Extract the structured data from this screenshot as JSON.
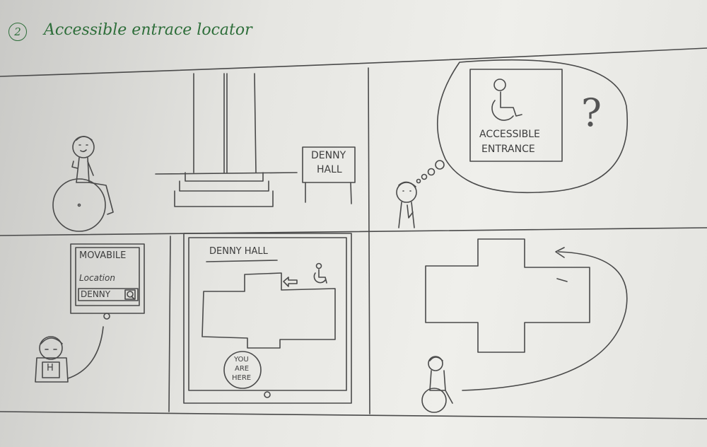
{
  "title": {
    "number": "2",
    "text": "Accessible entrace locator"
  },
  "panel1": {
    "sign_line1": "DENNY",
    "sign_line2": "HALL"
  },
  "panel2": {
    "sign_line1": "ACCESSIBLE",
    "sign_line2": "ENTRANCE",
    "question": "?"
  },
  "panel3": {
    "app_name": "MOVABILE",
    "field_label": "Location",
    "field_value": "DENNY",
    "badge_letter": "H"
  },
  "panel4": {
    "map_title": "DENNY HALL",
    "marker_line1": "YOU",
    "marker_line2": "ARE",
    "marker_line3": "HERE"
  },
  "colors": {
    "ink": "#4a4a4a",
    "title_green": "#2e6e3a"
  },
  "icons": [
    "wheelchair-icon",
    "search-icon",
    "arrow-left-icon"
  ]
}
